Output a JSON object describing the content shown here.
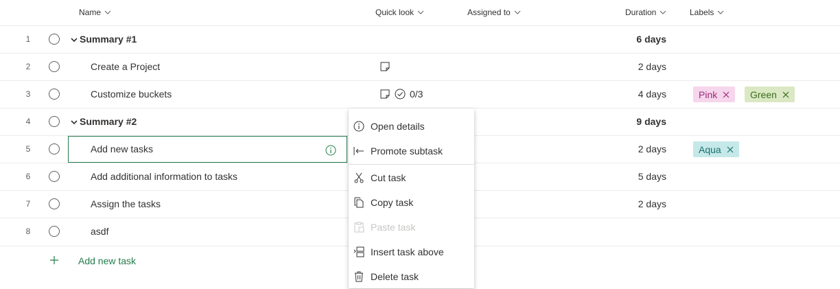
{
  "columns": {
    "name": "Name",
    "quick_look": "Quick look",
    "assigned_to": "Assigned to",
    "duration": "Duration",
    "labels": "Labels"
  },
  "rows": [
    {
      "num": "1",
      "title": "Summary #1",
      "duration": "6 days"
    },
    {
      "num": "2",
      "title": "Create a Project",
      "duration": "2 days"
    },
    {
      "num": "3",
      "title": "Customize buckets",
      "duration": "4 days",
      "checklist": "0/3",
      "labels": [
        {
          "text": "Pink",
          "bg": "#f6d6ec",
          "fg": "#9b2d7a"
        },
        {
          "text": "Green",
          "bg": "#dbe8c4",
          "fg": "#3b6d1d"
        }
      ]
    },
    {
      "num": "4",
      "title": "Summary #2",
      "duration": "9 days"
    },
    {
      "num": "5",
      "title": "Add new tasks",
      "duration": "2 days",
      "labels": [
        {
          "text": "Aqua",
          "bg": "#c5e8e8",
          "fg": "#1b6f6f"
        }
      ]
    },
    {
      "num": "6",
      "title": "Add additional information to tasks",
      "duration": "5 days"
    },
    {
      "num": "7",
      "title": "Assign the tasks",
      "duration": "2 days"
    },
    {
      "num": "8",
      "title": "asdf",
      "duration": ""
    }
  ],
  "add_task": "Add new task",
  "context_menu": {
    "open_details": "Open details",
    "promote_subtask": "Promote subtask",
    "cut_task": "Cut task",
    "copy_task": "Copy task",
    "paste_task": "Paste task",
    "insert_task_above": "Insert task above",
    "delete_task": "Delete task"
  },
  "colors": {
    "accent": "#237b4b",
    "text": "#323130",
    "muted": "#605e5c"
  }
}
